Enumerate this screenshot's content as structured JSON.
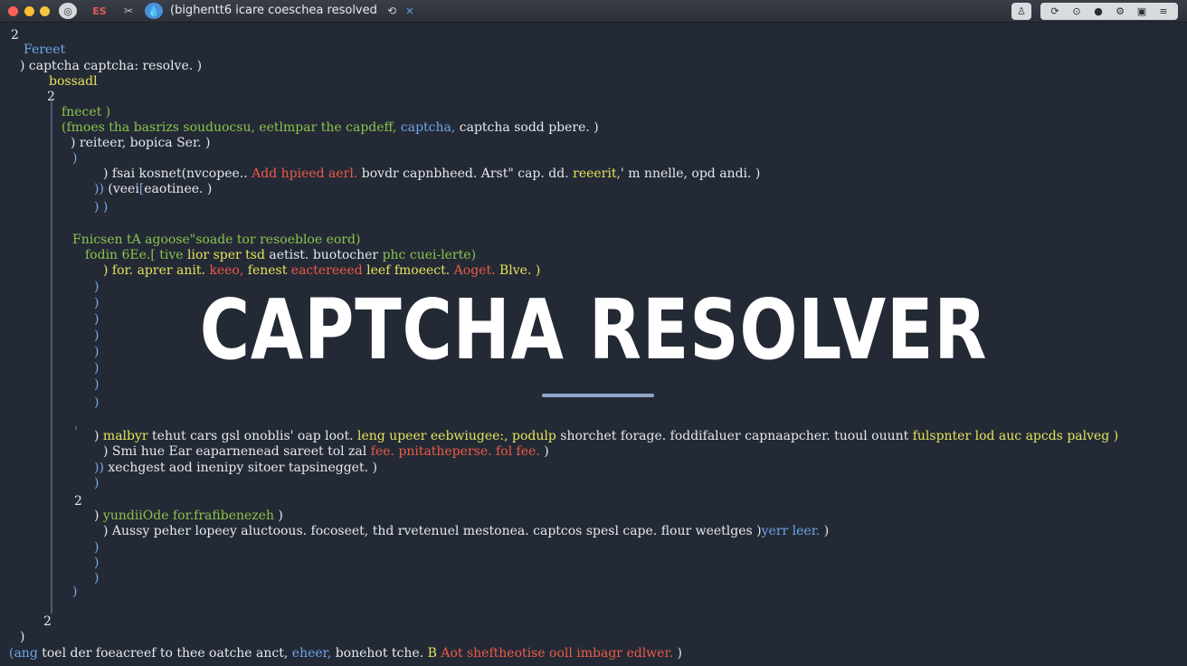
{
  "window": {
    "title": "(bighentt6 icare coeschea resolved",
    "app_badge": "ES",
    "colors": {
      "close": "#ff5f57",
      "minimize": "#febc2e",
      "zoom": "#f5c542",
      "background": "#232a36"
    },
    "left_icons": [
      "home-icon",
      "app-badge-icon",
      "tools-icon",
      "drop-icon",
      "sync-icon",
      "close-x-icon"
    ],
    "right_icons": [
      "user-icon",
      "refresh-icon",
      "search-icon",
      "stop-icon",
      "settings-icon",
      "clipboard-icon",
      "menu-icon"
    ]
  },
  "overlay": {
    "title": "CAPTCHA RESOLVER"
  },
  "code": {
    "lines": [
      {
        "key": "l01",
        "parts": [
          {
            "t": "2",
            "c": "white"
          }
        ]
      },
      {
        "key": "l02",
        "parts": [
          {
            "t": "Fereet",
            "c": "blue"
          }
        ]
      },
      {
        "key": "l03",
        "parts": [
          {
            "t": ") captcha captcha: resolve. )",
            "c": "white"
          }
        ]
      },
      {
        "key": "l04",
        "parts": [
          {
            "t": "bossadl",
            "c": "yellow"
          }
        ]
      },
      {
        "key": "l05",
        "parts": [
          {
            "t": "2",
            "c": "white"
          }
        ]
      },
      {
        "key": "l06",
        "parts": [
          {
            "t": "fnecet )",
            "c": "green"
          }
        ]
      },
      {
        "key": "l07",
        "parts": [
          {
            "t": "(fmoes tha basrizs souduocsu, eetlmpar the capdeff, ",
            "c": "green"
          },
          {
            "t": "captcha,",
            "c": "blue"
          },
          {
            "t": " captcha sodd pbere. )",
            "c": "white"
          }
        ]
      },
      {
        "key": "l08",
        "parts": [
          {
            "t": ") reiteer, bopica Ser. )",
            "c": "white"
          }
        ]
      },
      {
        "key": "l09",
        "parts": [
          {
            "t": ")",
            "c": "bracket"
          }
        ]
      },
      {
        "key": "l10",
        "parts": [
          {
            "t": ") fsai kosnet(nvcopee.. ",
            "c": "white"
          },
          {
            "t": "Add hpieed aerl.",
            "c": "red"
          },
          {
            "t": " bovdr capnbheed. Arst\" cap. dd. ",
            "c": "white"
          },
          {
            "t": "reeerit,",
            "c": "yellow"
          },
          {
            "t": "' m nnelle, opd andi. )",
            "c": "white"
          }
        ]
      },
      {
        "key": "l11",
        "parts": [
          {
            "t": ")) ",
            "c": "bracket"
          },
          {
            "t": "(veei",
            "c": "white"
          },
          {
            "t": "[",
            "c": "bracket"
          },
          {
            "t": "eaotinee. )",
            "c": "white"
          }
        ]
      },
      {
        "key": "l12",
        "parts": [
          {
            "t": ") )",
            "c": "bracket"
          }
        ]
      },
      {
        "key": "l13",
        "parts": [
          {
            "t": "Fnicsen tA agoose\"soade tor resoebloe eord)",
            "c": "green"
          }
        ]
      },
      {
        "key": "l14",
        "parts": [
          {
            "t": "fodin 6Ee.[ tive ",
            "c": "green"
          },
          {
            "t": "lior sper tsd ",
            "c": "yellow"
          },
          {
            "t": "aetist. buotocher ",
            "c": "white"
          },
          {
            "t": "phc cuei-lerte)",
            "c": "green"
          }
        ]
      },
      {
        "key": "l15",
        "parts": [
          {
            "t": ") for. aprer anit. ",
            "c": "yellow"
          },
          {
            "t": "keeo,",
            "c": "red"
          },
          {
            "t": " fenest ",
            "c": "yellow"
          },
          {
            "t": "eactereeed",
            "c": "red"
          },
          {
            "t": " leef fmoeect. ",
            "c": "yellow"
          },
          {
            "t": "Aoget.",
            "c": "red"
          },
          {
            "t": " Blve. )",
            "c": "yellow"
          }
        ]
      },
      {
        "key": "l16",
        "parts": [
          {
            "t": ")",
            "c": "bracket"
          }
        ]
      },
      {
        "key": "l17",
        "parts": [
          {
            "t": ")",
            "c": "bracket"
          }
        ]
      },
      {
        "key": "l18",
        "parts": [
          {
            "t": ")",
            "c": "bracket"
          }
        ]
      },
      {
        "key": "l19",
        "parts": [
          {
            "t": ")",
            "c": "bracket"
          }
        ]
      },
      {
        "key": "l20",
        "parts": [
          {
            "t": ")",
            "c": "bracket"
          }
        ]
      },
      {
        "key": "l21",
        "parts": [
          {
            "t": ")",
            "c": "bracket"
          }
        ]
      },
      {
        "key": "l22",
        "parts": [
          {
            "t": ")",
            "c": "bracket"
          }
        ]
      },
      {
        "key": "l23",
        "parts": [
          {
            "t": ")",
            "c": "bracket"
          }
        ]
      },
      {
        "key": "l24",
        "parts": [
          {
            "t": ") ",
            "c": "white"
          },
          {
            "t": "malbyr",
            "c": "yellow"
          },
          {
            "t": " tehut cars gsl onoblis' oap loot. ",
            "c": "white"
          },
          {
            "t": "leng upeer eebwiugee:, podulp",
            "c": "yellow"
          },
          {
            "t": " shorchet ",
            "c": "white"
          },
          {
            "t": "forage. foddifaluer capnaapcher. tuoul ouunt ",
            "c": "white"
          },
          {
            "t": "fulspnter lod auc apcds palveg )",
            "c": "yellow"
          }
        ]
      },
      {
        "key": "l25",
        "parts": [
          {
            "t": ") Smi hue ",
            "c": "white"
          },
          {
            "t": "Ear ",
            "c": "white"
          },
          {
            "t": "eaparnenead sareet tol zal ",
            "c": "white"
          },
          {
            "t": "fee. pnitatheperse. fol fee.",
            "c": "red"
          },
          {
            "t": " )",
            "c": "white"
          }
        ]
      },
      {
        "key": "l26",
        "parts": [
          {
            "t": ")) ",
            "c": "bracket"
          },
          {
            "t": "xechgest aod inenipy sitoer tapsinegget. )",
            "c": "white"
          }
        ]
      },
      {
        "key": "l27",
        "parts": [
          {
            "t": ")",
            "c": "bracket"
          }
        ]
      },
      {
        "key": "l28",
        "parts": [
          {
            "t": "2",
            "c": "white"
          }
        ]
      },
      {
        "key": "l29",
        "parts": [
          {
            "t": ") ",
            "c": "white"
          },
          {
            "t": "yundiiOde for.frafibenezeh",
            "c": "green"
          },
          {
            "t": " )",
            "c": "white"
          }
        ]
      },
      {
        "key": "l30",
        "parts": [
          {
            "t": ") Aussy peher ",
            "c": "white"
          },
          {
            "t": "lopeey aluctoous. focoseet, thd rvetenuel mestonea. captcos spesl cape. flour weetlges )",
            "c": "white"
          },
          {
            "t": "yerr leer.",
            "c": "blue"
          },
          {
            "t": " )",
            "c": "white"
          }
        ]
      },
      {
        "key": "l31",
        "parts": [
          {
            "t": ")",
            "c": "bracket"
          }
        ]
      },
      {
        "key": "l32",
        "parts": [
          {
            "t": ")",
            "c": "bracket"
          }
        ]
      },
      {
        "key": "l33",
        "parts": [
          {
            "t": ")",
            "c": "bracket"
          }
        ]
      },
      {
        "key": "l34",
        "parts": [
          {
            "t": ")",
            "c": "bracket"
          }
        ]
      },
      {
        "key": "l35",
        "parts": [
          {
            "t": "2",
            "c": "white"
          }
        ]
      },
      {
        "key": "l36",
        "parts": [
          {
            "t": ")",
            "c": "white"
          }
        ]
      },
      {
        "key": "l37",
        "parts": [
          {
            "t": "(ang",
            "c": "blue"
          },
          {
            "t": " toel der foeacreef to thee oatche anct, ",
            "c": "white"
          },
          {
            "t": "eheer,",
            "c": "blue"
          },
          {
            "t": " bonehot tche. ",
            "c": "white"
          },
          {
            "t": "B",
            "c": "yellow"
          },
          {
            "t": " Aot sheftheotise ooll imbagr edlwer.",
            "c": "red"
          },
          {
            "t": " )",
            "c": "white"
          }
        ]
      }
    ]
  }
}
